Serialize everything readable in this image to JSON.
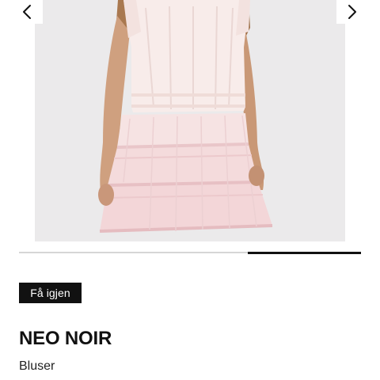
{
  "gallery": {
    "image_alt": "Hvit bluse og rosa skjørt",
    "prev_icon": "chevron-left-icon",
    "next_icon": "chevron-right-icon",
    "progress": 0.33
  },
  "badge": {
    "label": "Få igjen"
  },
  "product": {
    "brand": "NEO NOIR",
    "category": "Bluser"
  },
  "colors": {
    "badge_bg": "#111111",
    "progress_fill": "#111111",
    "progress_track": "#d6d6d6",
    "photo_bg": "#ebeaeb"
  }
}
